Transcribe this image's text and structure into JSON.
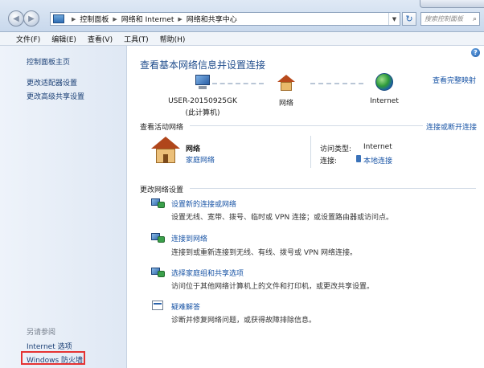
{
  "address": {
    "breadcrumbs": [
      "控制面板",
      "网络和 Internet",
      "网络和共享中心"
    ],
    "search_placeholder": "搜索控制面板"
  },
  "menu": [
    "文件(F)",
    "编辑(E)",
    "查看(V)",
    "工具(T)",
    "帮助(H)"
  ],
  "sidebar": {
    "links": [
      "控制面板主页",
      "更改适配器设置",
      "更改高级共享设置"
    ],
    "see_also_heading": "另请参阅",
    "see_also": [
      "Internet 选项",
      "Windows 防火墙"
    ]
  },
  "main": {
    "title": "查看基本网络信息并设置连接",
    "full_map_link": "查看完整映射",
    "map": {
      "computer_name": "USER-20150925GK",
      "computer_sub": "(此计算机)",
      "network_label": "网络",
      "internet_label": "Internet"
    },
    "active_heading": "查看活动网络",
    "connect_link": "连接或断开连接",
    "active_network": {
      "name": "网络",
      "type": "家庭网络",
      "access_type_label": "访问类型:",
      "access_type_value": "Internet",
      "connections_label": "连接:",
      "connections_value": "本地连接"
    },
    "change_heading": "更改网络设置",
    "tasks": [
      {
        "link": "设置新的连接或网络",
        "desc": "设置无线、宽带、拨号、临时或 VPN 连接；或设置路由器或访问点。"
      },
      {
        "link": "连接到网络",
        "desc": "连接到或重新连接到无线、有线、拨号或 VPN 网络连接。"
      },
      {
        "link": "选择家庭组和共享选项",
        "desc": "访问位于其他网络计算机上的文件和打印机，或更改共享设置。"
      },
      {
        "link": "疑难解答",
        "desc": "诊断并修复网络问题，或获得故障排除信息。"
      }
    ]
  },
  "colors": {
    "link": "#1a55a6",
    "title": "#1f4c8c",
    "highlight_box": "#e53333"
  }
}
